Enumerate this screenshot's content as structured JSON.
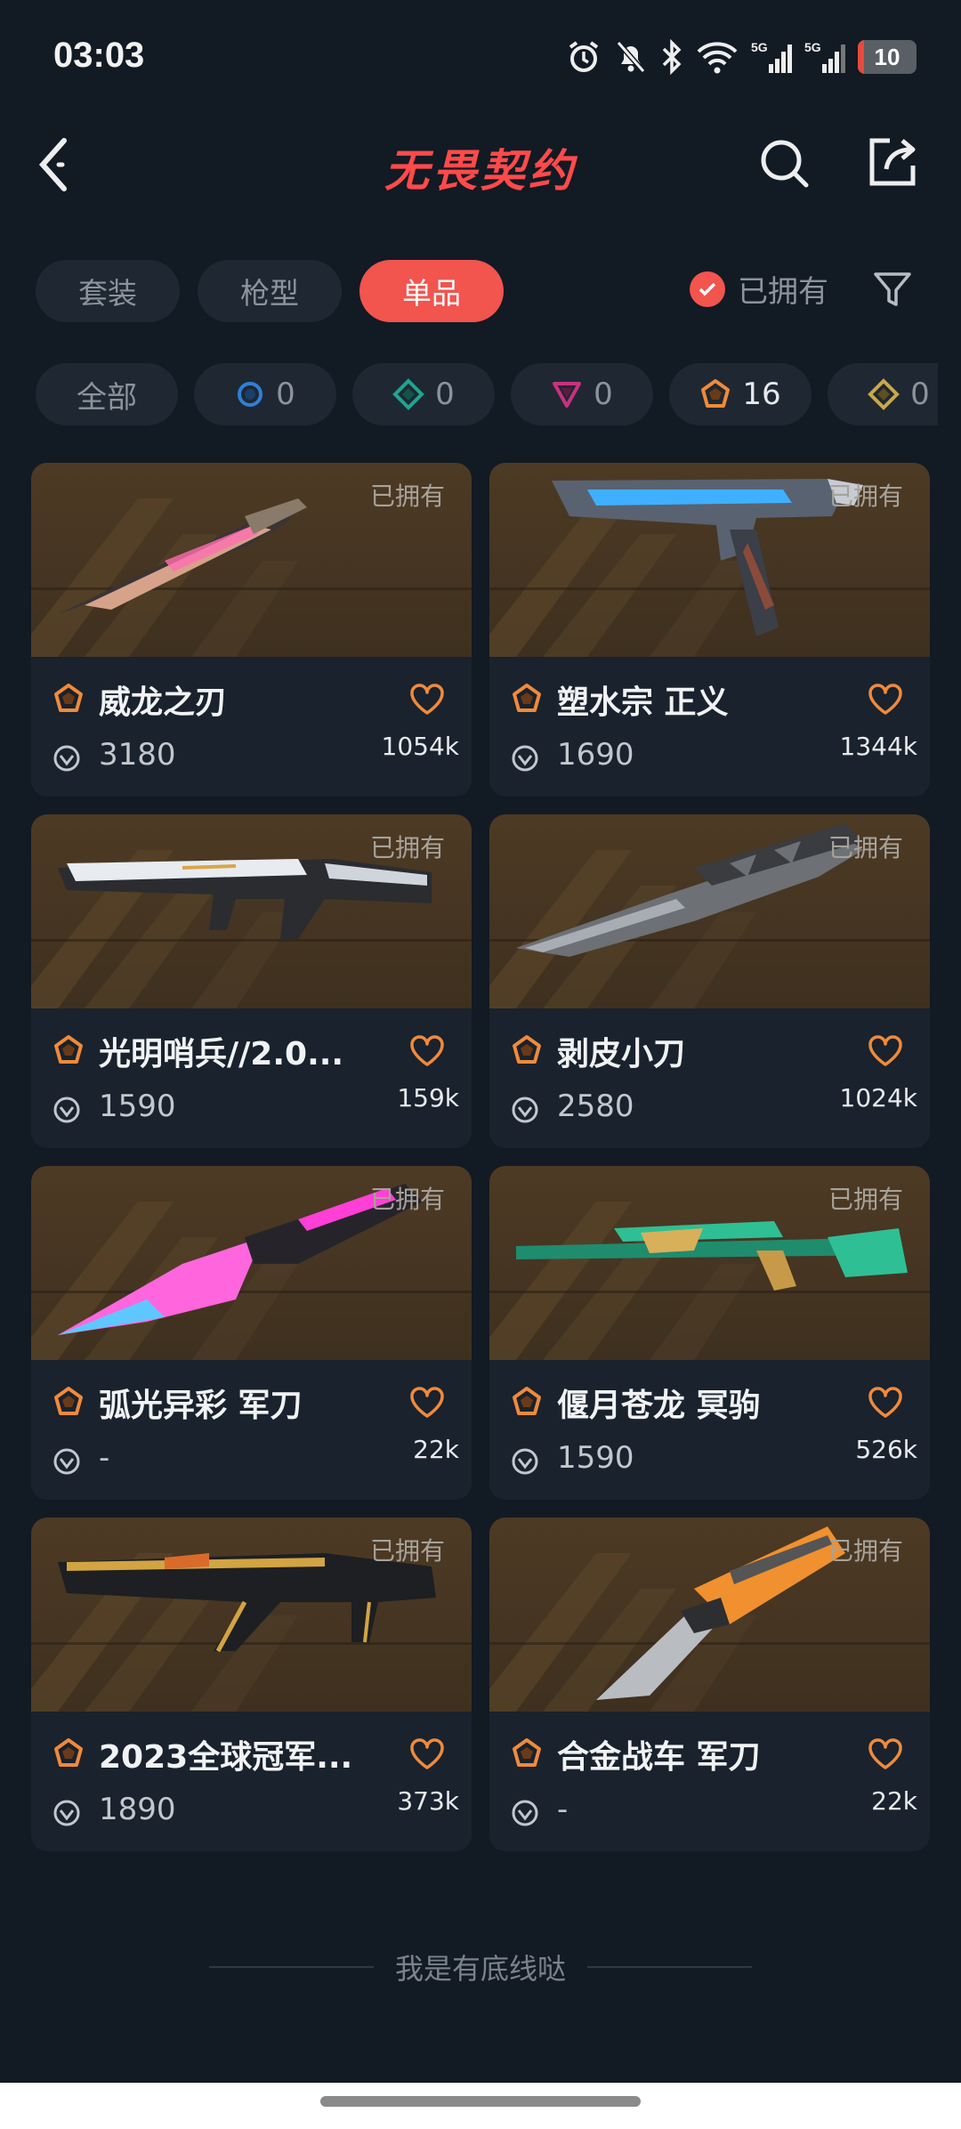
{
  "status": {
    "time": "03:03",
    "battery": "10",
    "battery_level": 0.1
  },
  "header": {
    "title": "无畏契约"
  },
  "tabs": [
    {
      "label": "套装",
      "active": false
    },
    {
      "label": "枪型",
      "active": false
    },
    {
      "label": "单品",
      "active": true
    }
  ],
  "owned_filter": {
    "label": "已拥有",
    "checked": true
  },
  "rarity_filters": [
    {
      "label": "全部"
    },
    {
      "icon": "select-tier-icon",
      "color": "#2f7fd6",
      "count": "0"
    },
    {
      "icon": "deluxe-tier-icon",
      "color": "#1ea591",
      "count": "0"
    },
    {
      "icon": "premium-tier-icon",
      "color": "#c9317f",
      "count": "0"
    },
    {
      "icon": "exclusive-tier-icon",
      "color": "#f08a3a",
      "count": "16"
    },
    {
      "icon": "ultra-tier-icon",
      "color": "#c8a84a",
      "count": "0"
    }
  ],
  "items": [
    {
      "name": "威龙之刃",
      "price": "3180",
      "likes": "1054k",
      "owned": "已拥有",
      "weapon": "knife-pink"
    },
    {
      "name": "塑水宗 正义",
      "price": "1690",
      "likes": "1344k",
      "owned": "已拥有",
      "weapon": "pistol-blue"
    },
    {
      "name": "光明哨兵//2.0...",
      "price": "1590",
      "likes": "159k",
      "owned": "已拥有",
      "weapon": "rifle-white"
    },
    {
      "name": "剥皮小刀",
      "price": "2580",
      "likes": "1024k",
      "owned": "已拥有",
      "weapon": "knife-gray"
    },
    {
      "name": "弧光异彩 军刀",
      "price": "-",
      "likes": "22k",
      "owned": "已拥有",
      "weapon": "knife-magenta"
    },
    {
      "name": "偃月苍龙 冥驹",
      "price": "1590",
      "likes": "526k",
      "owned": "已拥有",
      "weapon": "sniper-green"
    },
    {
      "name": "2023全球冠军...",
      "price": "1890",
      "likes": "373k",
      "owned": "已拥有",
      "weapon": "rifle-gold"
    },
    {
      "name": "合金战车 军刀",
      "price": "-",
      "likes": "22k",
      "owned": "已拥有",
      "weapon": "knife-orange"
    }
  ],
  "footer": {
    "text": "我是有底线哒"
  }
}
